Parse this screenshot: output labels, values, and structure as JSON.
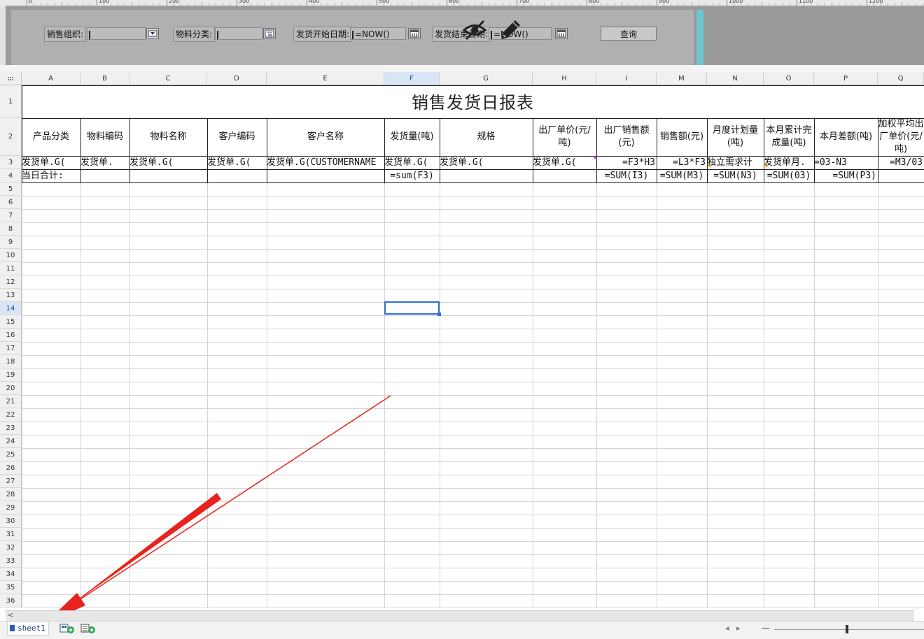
{
  "ruler": {
    "labels": [
      "0",
      "100",
      "200",
      "300",
      "400",
      "500",
      "600",
      "700",
      "800",
      "900",
      "1000",
      "1100",
      "1200"
    ]
  },
  "params": {
    "org_label": "销售组织:",
    "category_label": "物料分类:",
    "start_date_label": "发货开始日期:",
    "start_date_value": "=NOW()",
    "end_date_label": "发货结束日期:",
    "end_date_value": "=NOW()",
    "query_button": "查询"
  },
  "columns": [
    "A",
    "B",
    "C",
    "D",
    "E",
    "F",
    "G",
    "H",
    "I",
    "M",
    "N",
    "O",
    "P",
    "Q"
  ],
  "selected_column": "F",
  "rows": [
    "1",
    "2",
    "3",
    "4",
    "5",
    "6",
    "7",
    "8",
    "9",
    "10",
    "11",
    "12",
    "13",
    "14",
    "15",
    "16",
    "17",
    "18",
    "19",
    "20",
    "21",
    "22",
    "23",
    "24",
    "25",
    "26",
    "27",
    "28",
    "29",
    "30",
    "31",
    "32",
    "33",
    "34",
    "35",
    "36"
  ],
  "selected_row": "14",
  "report": {
    "title": "销售发货日报表",
    "headers": [
      "产品分类",
      "物料编码",
      "物料名称",
      "客户编码",
      "客户名称",
      "发货量(吨)",
      "规格",
      "出厂单价(元/吨)",
      "出厂销售额(元)",
      "销售额(元)",
      "月度计划量(吨)",
      "本月累计完成量(吨)",
      "本月差额(吨)",
      "加权平均出厂单价(元/吨)"
    ],
    "row3": [
      "发货单.G(",
      "发货单.",
      "发货单.G(",
      "发货单.G(",
      "发货单.G(CUSTOMERNAME",
      "发货单.G(",
      "发货单.G(",
      "发货单.G(",
      "=F3*H3",
      "=L3*F3",
      "独立需求计",
      "发货单月.",
      "=03-N3",
      "=M3/03"
    ],
    "row4": [
      "当日合计:",
      "",
      "",
      "",
      "",
      "=sum(F3)",
      "",
      "",
      "=SUM(I3)",
      "=SUM(M3)",
      "=SUM(N3)",
      "=SUM(03)",
      "=SUM(P3)",
      ""
    ]
  },
  "sheet_tab": "sheet1",
  "colors": {
    "selection": "#2f6fd6",
    "panel": "#9a9a9a",
    "stripe": "#6cc6d0",
    "arrow": "#e8231e"
  }
}
